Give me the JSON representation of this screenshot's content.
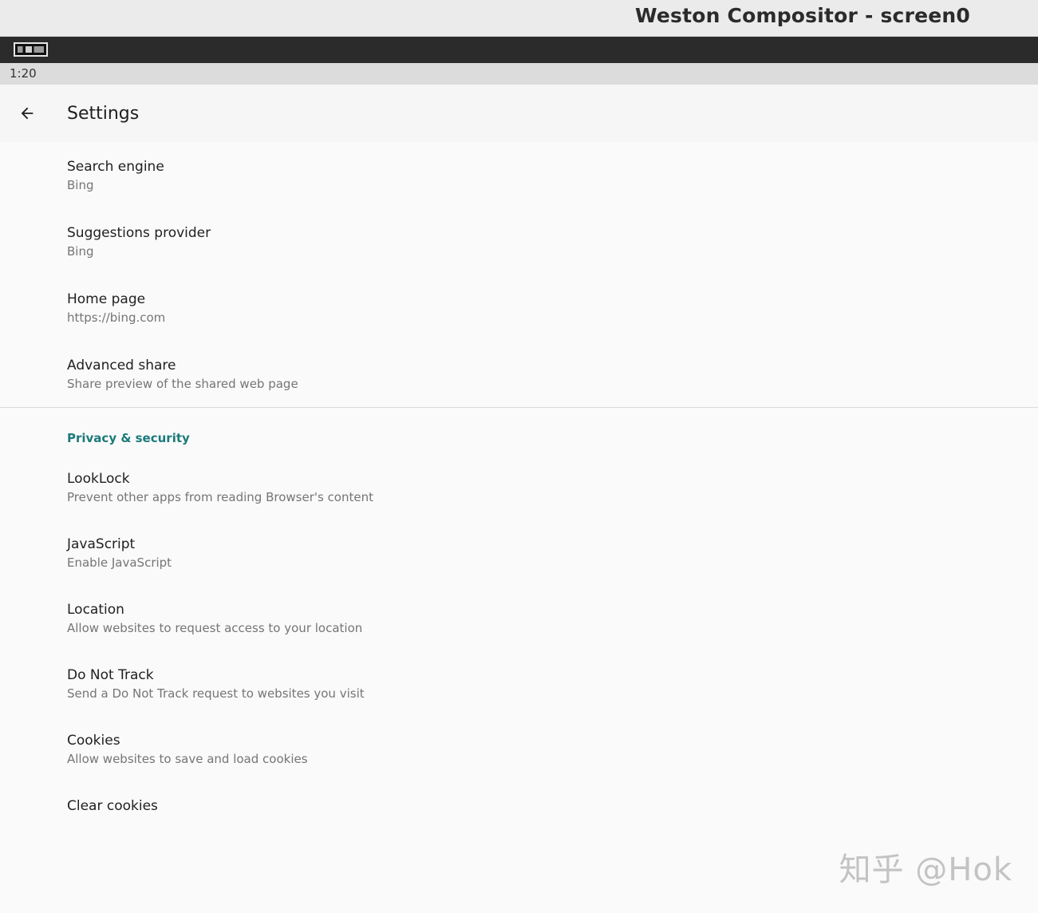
{
  "window": {
    "title": "Weston Compositor - screen0"
  },
  "panel": {
    "launcher_icon": "terminal-icon"
  },
  "statusbar": {
    "time": "1:20"
  },
  "appbar": {
    "back_icon": "arrow-left-icon",
    "title": "Settings"
  },
  "general": [
    {
      "title": "Search engine",
      "summary": "Bing"
    },
    {
      "title": "Suggestions provider",
      "summary": "Bing"
    },
    {
      "title": "Home page",
      "summary": "https://bing.com"
    },
    {
      "title": "Advanced share",
      "summary": "Share preview of the shared web page"
    }
  ],
  "privacy": {
    "category_title": "Privacy & security",
    "items": [
      {
        "title": "LookLock",
        "summary": "Prevent other apps from reading Browser's content"
      },
      {
        "title": "JavaScript",
        "summary": "Enable JavaScript"
      },
      {
        "title": "Location",
        "summary": "Allow websites to request access to your location"
      },
      {
        "title": "Do Not Track",
        "summary": "Send a Do Not Track request to websites you visit"
      },
      {
        "title": "Cookies",
        "summary": "Allow websites to save and load cookies"
      },
      {
        "title": "Clear cookies"
      }
    ]
  },
  "watermark": {
    "text": "知乎 @Hok"
  },
  "colors": {
    "accent": "#1c7a7a",
    "panel": "#2b2b2b",
    "background": "#fafafa"
  }
}
